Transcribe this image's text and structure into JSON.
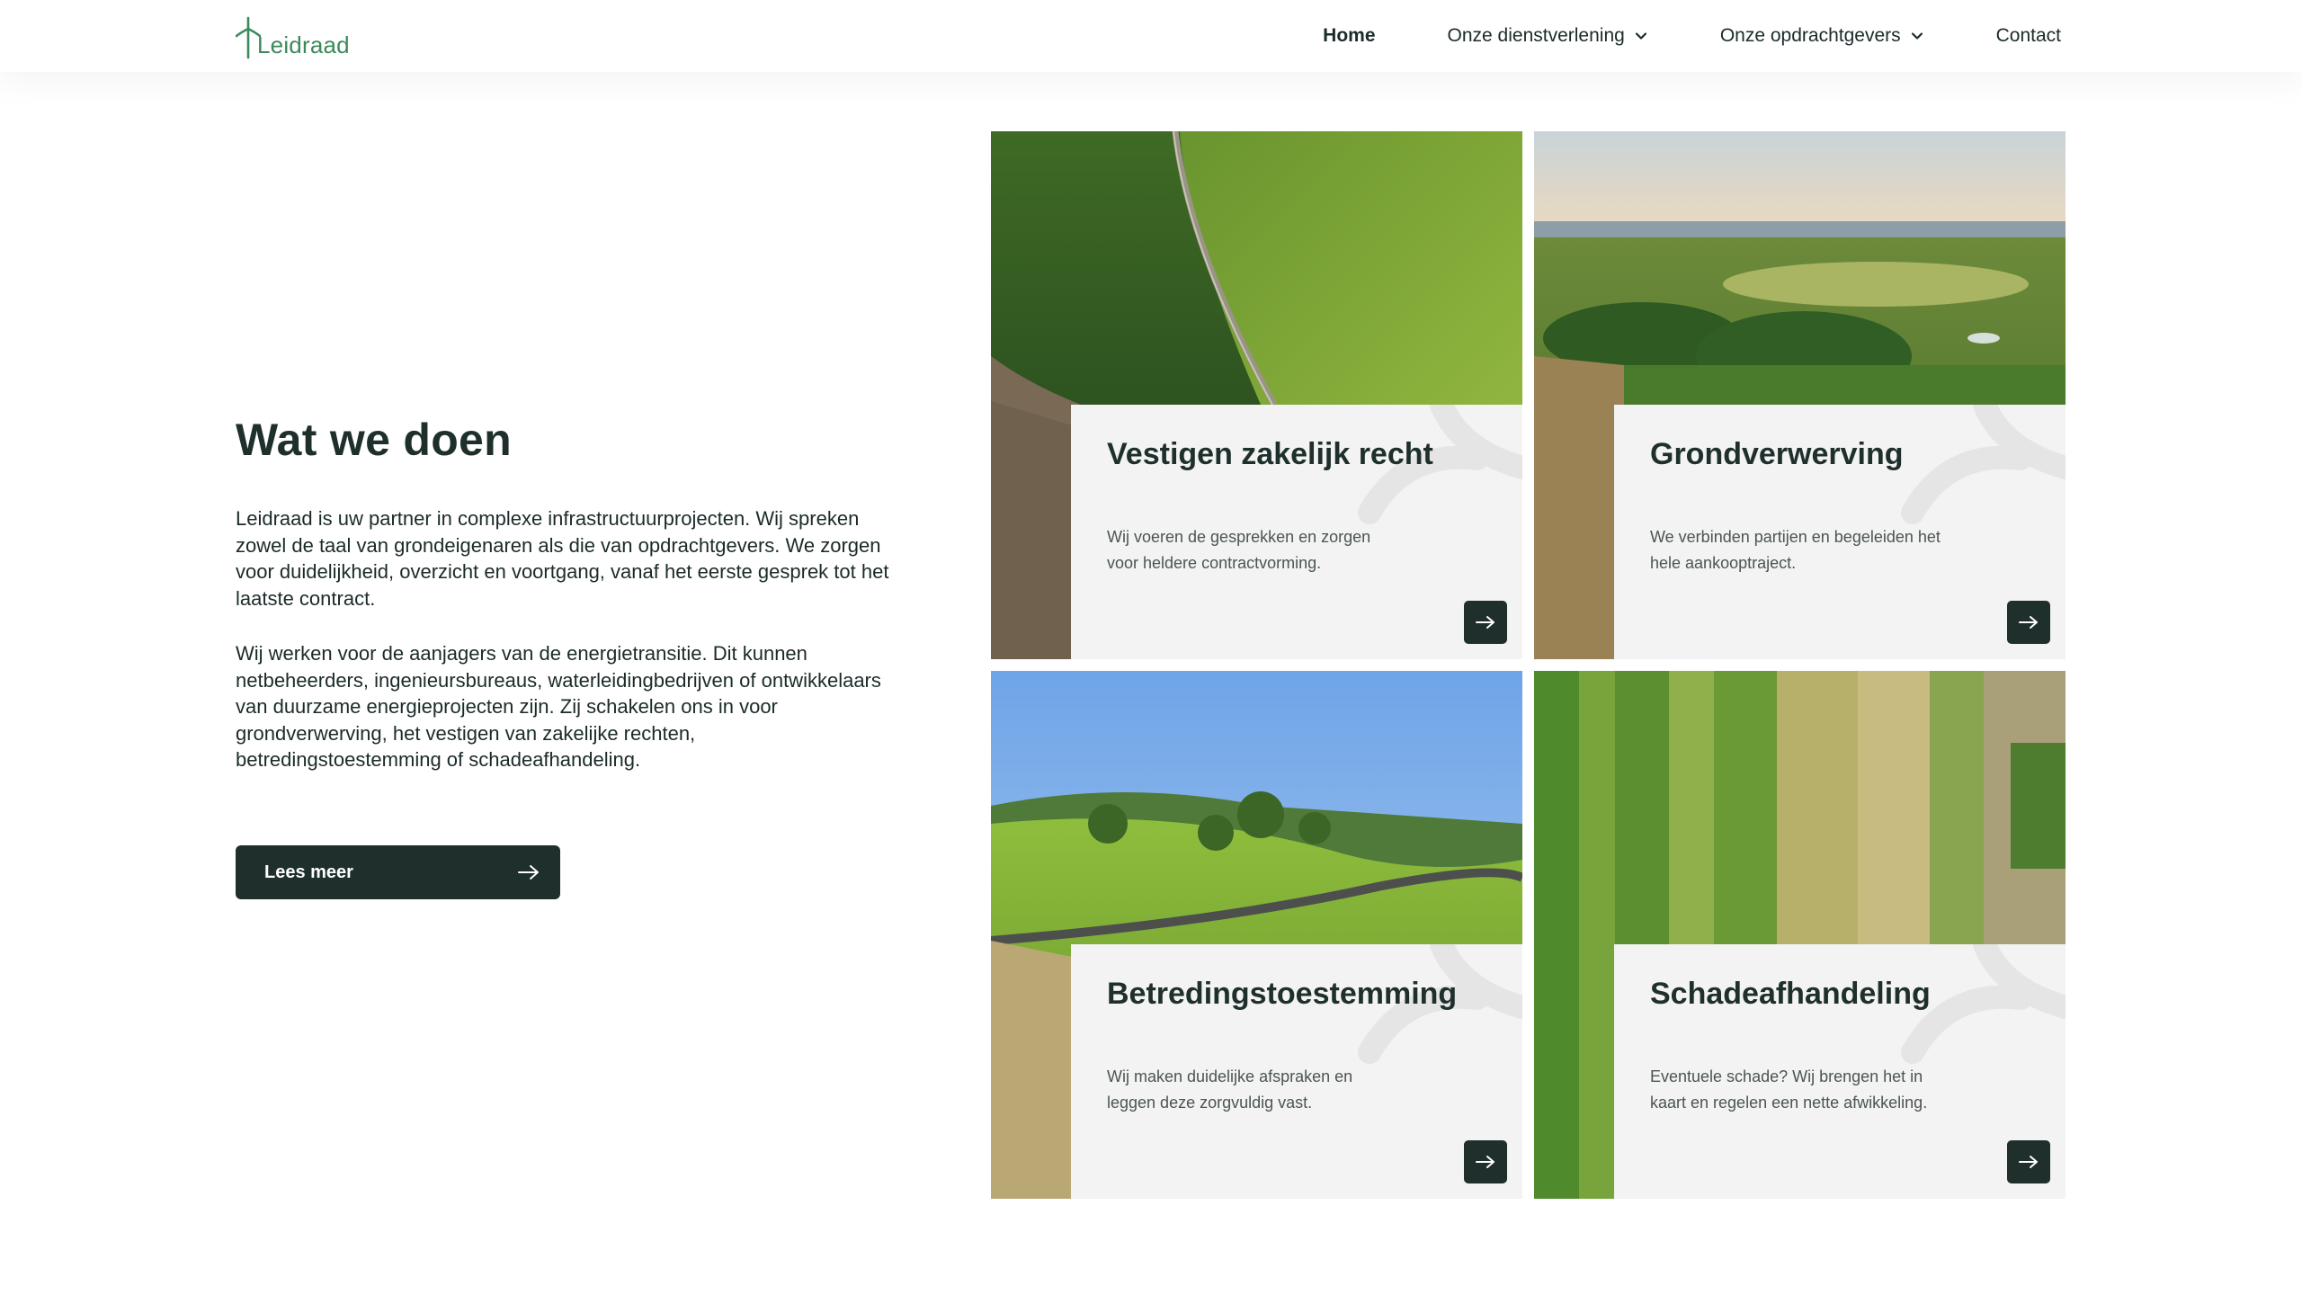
{
  "brand": {
    "name": "Leidraad",
    "color": "#3b8a5a"
  },
  "nav": {
    "items": [
      {
        "label": "Home",
        "active": true,
        "dropdown": false
      },
      {
        "label": "Onze dienstverlening",
        "active": false,
        "dropdown": true
      },
      {
        "label": "Onze opdrachtgevers",
        "active": false,
        "dropdown": true
      },
      {
        "label": "Contact",
        "active": false,
        "dropdown": false
      }
    ]
  },
  "intro": {
    "heading": "Wat we doen",
    "paragraph1": "Leidraad is uw partner in complexe infrastructuurprojecten. Wij spreken zowel de taal van grondeigenaren als die van opdrachtgevers. We zorgen voor duidelijkheid, overzicht en voortgang, vanaf het eerste gesprek tot het laatste contract.",
    "paragraph2": "Wij werken voor de aanjagers van de energietransitie. Dit kunnen netbeheerders, ingenieursbureaus, waterleidingbedrijven of ontwikkelaars van duurzame energieprojecten zijn. Zij schakelen ons in voor grondverwerving, het vestigen van zakelijke rechten, betredingstoestemming of schadeafhandeling.",
    "button_label": "Lees meer"
  },
  "cards": [
    {
      "title": "Vestigen zakelijk recht",
      "description": "Wij voeren de gesprekken en zorgen voor heldere contractvorming.",
      "image": "aerial-green-field-road"
    },
    {
      "title": "Grondverwerving",
      "description": "We verbinden partijen en begeleiden het hele aankooptraject.",
      "image": "landscape-lake-trees"
    },
    {
      "title": "Betredingstoestemming",
      "description": "Wij maken duidelijke afspraken en leggen deze zorgvuldig vast.",
      "image": "hills-trees-road"
    },
    {
      "title": "Schadeafhandeling",
      "description": "Eventuele schade? Wij brengen het in kaart en regelen een nette afwikkeling.",
      "image": "aerial-crop-strips"
    }
  ],
  "colors": {
    "dark": "#1e2f2c",
    "panel": "#f2f3f2",
    "accent_green": "#3b8a5a"
  },
  "icons": [
    "chevron-down-icon",
    "arrow-right-icon",
    "logo-mark-icon"
  ]
}
